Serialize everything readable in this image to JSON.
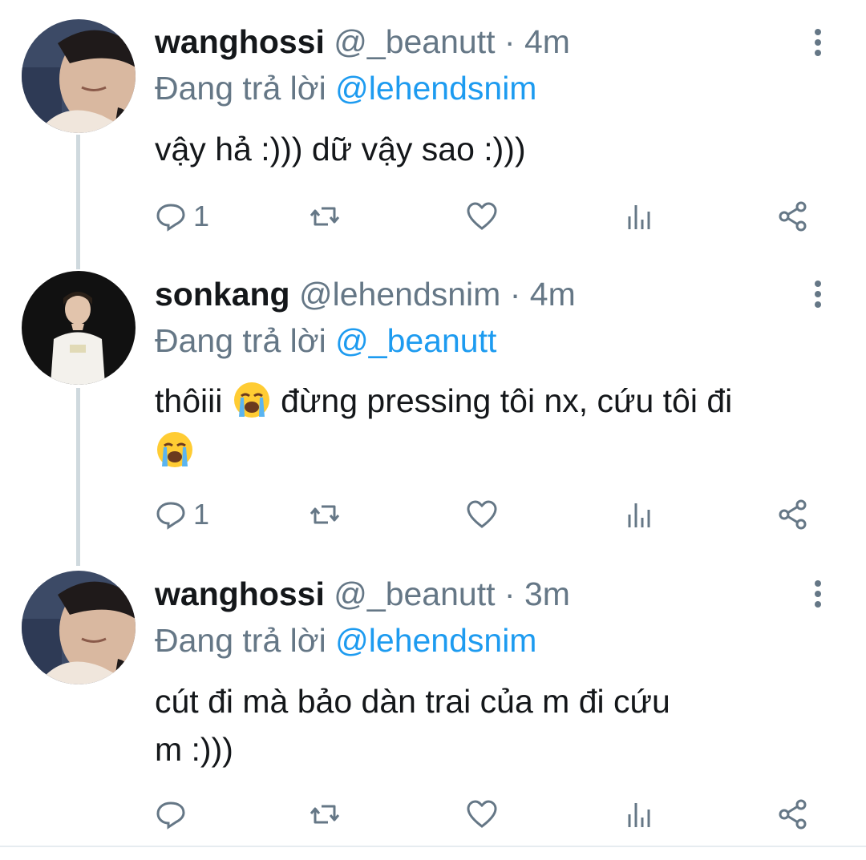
{
  "tweets": [
    {
      "display_name": "wanghossi",
      "handle": "@_beanutt",
      "separator": "·",
      "time": "4m",
      "reply_prefix": "Đang trả lời",
      "reply_to": "@lehendsnim",
      "text_lines": [
        "vậy hả :))) dữ vậy sao :)))"
      ],
      "reply_count": "1",
      "avatar": "wanghossi-avatar"
    },
    {
      "display_name": "sonkang",
      "handle": "@lehendsnim",
      "separator": "·",
      "time": "4m",
      "reply_prefix": "Đang trả lời",
      "reply_to": "@_beanutt",
      "text_before_emoji": "thôiii",
      "text_after_emoji": "đừng pressing tôi nx, cứu tôi đi",
      "reply_count": "1",
      "avatar": "sonkang-avatar",
      "emoji": "loudly-crying-face"
    },
    {
      "display_name": "wanghossi",
      "handle": "@_beanutt",
      "separator": "·",
      "time": "3m",
      "reply_prefix": "Đang trả lời",
      "reply_to": "@lehendsnim",
      "text_lines": [
        "cút đi mà bảo dàn trai của m đi cứu",
        "m :)))"
      ],
      "reply_count": "",
      "avatar": "wanghossi-avatar"
    }
  ],
  "colors": {
    "text": "#14171a",
    "secondary": "#657786",
    "link": "#1d9bf0",
    "thread_line": "#cfd9de"
  },
  "icons": [
    "reply-icon",
    "retweet-icon",
    "like-icon",
    "analytics-icon",
    "share-icon",
    "more-options-icon"
  ]
}
